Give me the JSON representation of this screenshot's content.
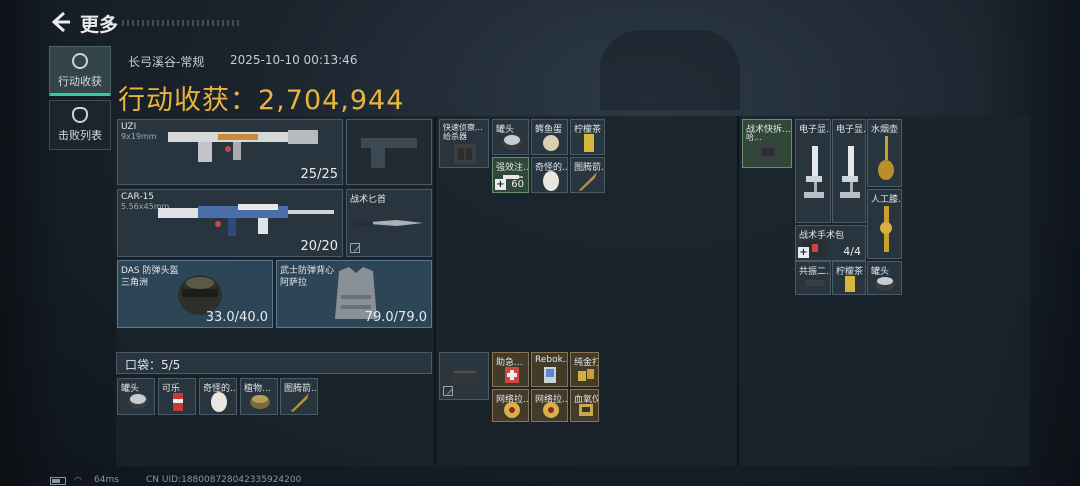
{
  "header": {
    "title": "更多"
  },
  "side_tabs": [
    {
      "label": "行动收获",
      "active": true
    },
    {
      "label": "击败列表",
      "active": false
    }
  ],
  "info": {
    "map": "长弓溪谷-常规",
    "timestamp": "2025-10-10 00:13:46",
    "harvest_label": "行动收获：",
    "harvest_value": "2,704,944"
  },
  "equipment": {
    "primary": {
      "name": "UZI",
      "caliber": "9x19mm",
      "ammo": "25/25"
    },
    "secondary": {
      "name": "CAR-15",
      "caliber": "5.56x45mm",
      "ammo": "20/20"
    },
    "melee": {
      "name": "战术匕首"
    },
    "helmet": {
      "name": "DAS 防弹头盔",
      "sub": "三角洲",
      "durability": "33.0/40.0"
    },
    "armor": {
      "name": "武士防弹背心",
      "sub": "阿萨拉",
      "durability": "79.0/79.0"
    }
  },
  "pocket": {
    "title": "口袋：5/5",
    "items": [
      "罐头",
      "可乐",
      "奇怪的...",
      "植物...",
      "图腾箭..."
    ]
  },
  "rig": {
    "name": "快速侦察...",
    "name2": "给杀器",
    "items": [
      "罐头",
      "鳄鱼蛋",
      "柠檬茶",
      "强效注...",
      "奇怪的...",
      "图腾箭..."
    ],
    "stack_count": "60"
  },
  "backpack_case": {
    "items": [
      "助急...",
      "Rebok...",
      "纯金打...",
      "网络拉...",
      "网络拉...",
      "血氧仪"
    ]
  },
  "backpack": {
    "name": "战术快拆...",
    "sub": "哈...",
    "items": [
      "电子显...",
      "电子显...",
      "水烟壶",
      "人工膝...",
      "战术手术包",
      "共振二...",
      "柠檬茶",
      "罐头"
    ],
    "medkit_count": "4/4"
  },
  "footer": {
    "ping": "64ms",
    "uid": "CN UID:18800872804233592420​0"
  },
  "colors": {
    "accent": "#2ecf9a",
    "harvest": "#e8b43f",
    "gold_slot": "#664e26",
    "blue_slot": "#304a5c"
  }
}
